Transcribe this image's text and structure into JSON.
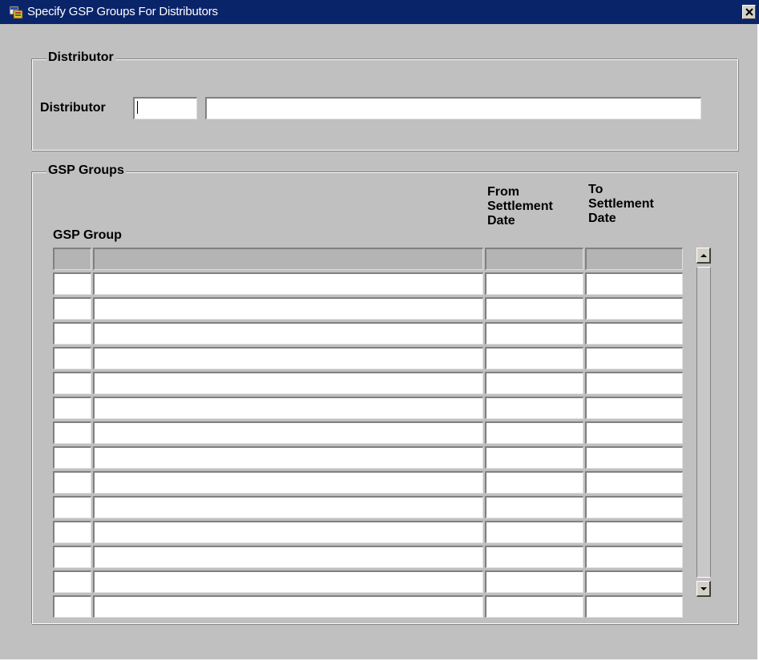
{
  "window": {
    "title": "Specify GSP Groups For Distributors",
    "colors": {
      "titlebar": "#0a246a",
      "face": "#c0c0c0",
      "field": "#ffffff"
    }
  },
  "distributor_section": {
    "legend": "Distributor",
    "label": "Distributor",
    "code_value": "",
    "name_value": ""
  },
  "gsp_section": {
    "legend": "GSP Groups",
    "columns": {
      "gsp_group": "GSP Group",
      "from_date": "From\nSettlement\nDate",
      "to_date": "To\nSettlement\nDate"
    },
    "rows": [
      {
        "indicator": "",
        "group": "",
        "from": "",
        "to": ""
      },
      {
        "indicator": "",
        "group": "",
        "from": "",
        "to": ""
      },
      {
        "indicator": "",
        "group": "",
        "from": "",
        "to": ""
      },
      {
        "indicator": "",
        "group": "",
        "from": "",
        "to": ""
      },
      {
        "indicator": "",
        "group": "",
        "from": "",
        "to": ""
      },
      {
        "indicator": "",
        "group": "",
        "from": "",
        "to": ""
      },
      {
        "indicator": "",
        "group": "",
        "from": "",
        "to": ""
      },
      {
        "indicator": "",
        "group": "",
        "from": "",
        "to": ""
      },
      {
        "indicator": "",
        "group": "",
        "from": "",
        "to": ""
      },
      {
        "indicator": "",
        "group": "",
        "from": "",
        "to": ""
      },
      {
        "indicator": "",
        "group": "",
        "from": "",
        "to": ""
      },
      {
        "indicator": "",
        "group": "",
        "from": "",
        "to": ""
      },
      {
        "indicator": "",
        "group": "",
        "from": "",
        "to": ""
      },
      {
        "indicator": "",
        "group": "",
        "from": "",
        "to": ""
      }
    ]
  },
  "icons": {
    "app": "oracle-forms-icon",
    "close": "close-icon",
    "scroll_up": "arrow-up-icon",
    "scroll_down": "arrow-down-icon"
  }
}
